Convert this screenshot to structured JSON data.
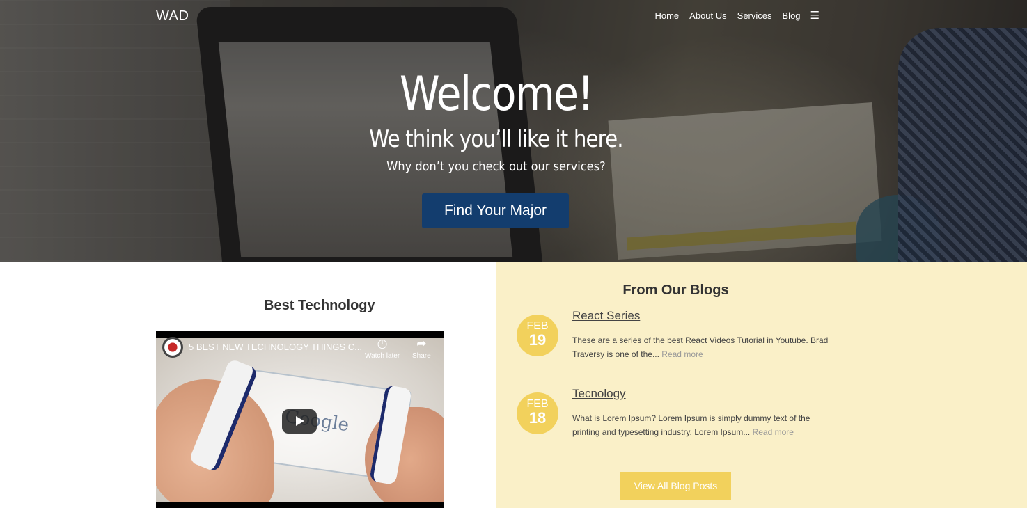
{
  "nav": {
    "brand": "WAD",
    "items": [
      {
        "label": "Home"
      },
      {
        "label": "About Us"
      },
      {
        "label": "Services"
      },
      {
        "label": "Blog"
      }
    ],
    "menu_icon": "hamburger-menu-icon"
  },
  "hero": {
    "title": "Welcome!",
    "subtitle": "We think you’ll like it here.",
    "tagline": "Why don’t you check out our services?",
    "cta_label": "Find Your Major",
    "cta_color": "#133d6e"
  },
  "technology": {
    "heading": "Best Technology",
    "video": {
      "title": "5 BEST NEW TECHNOLOGY THINGS C...",
      "watch_later_label": "Watch later",
      "share_label": "Share",
      "watermark_text": "Google"
    }
  },
  "blog": {
    "heading": "From Our Blogs",
    "accent_color": "#f2d15c",
    "background_color": "#faf0c8",
    "posts": [
      {
        "month": "FEB",
        "day": "19",
        "title": "React Series",
        "excerpt": "These are a series of the best React Videos Tutorial in Youtube. Brad Traversy is one of the...",
        "read_more": "Read more"
      },
      {
        "month": "FEB",
        "day": "18",
        "title": "Tecnology",
        "excerpt": "What is Lorem Ipsum? Lorem Ipsum is simply dummy text of the printing and typesetting industry. Lorem Ipsum...",
        "read_more": "Read more"
      }
    ],
    "view_all_label": "View All Blog Posts"
  }
}
